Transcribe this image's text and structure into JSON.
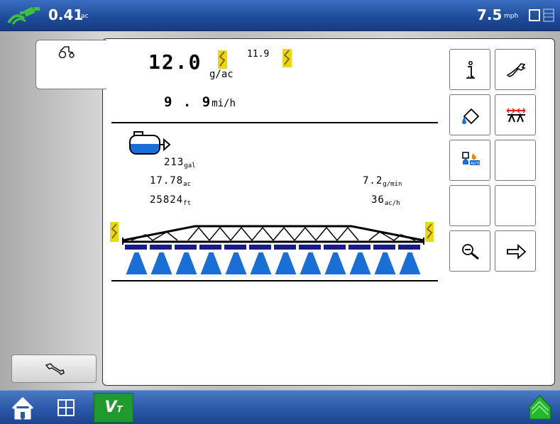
{
  "top_bar": {
    "area_value": "0.41",
    "area_unit": "ac",
    "speed_value": "7.5",
    "speed_unit": "mph"
  },
  "rate": {
    "actual": "12.0",
    "target": "11.9",
    "unit": "g/ac"
  },
  "ground_speed": {
    "value": "9 . 9",
    "unit": "mi/h"
  },
  "tank": {
    "volume": "213",
    "volume_unit": "gal"
  },
  "stats": {
    "area_covered": "17.78",
    "area_unit": "ac",
    "flow_rate": "7.2",
    "flow_unit": "g/min",
    "distance": "25824",
    "distance_unit": "ft",
    "productivity": "36",
    "productivity_unit": "ac/h"
  },
  "boom": {
    "section_count": 12
  },
  "bottom_bar": {
    "vt_label": "V",
    "vt_sub": "T"
  },
  "colors": {
    "bar_blue": "#2a58a8",
    "spray_blue": "#1a6fd6",
    "section_navy": "#1a1a8c",
    "flag_yellow": "#e8d81a",
    "vt_green": "#1e9a2e"
  }
}
